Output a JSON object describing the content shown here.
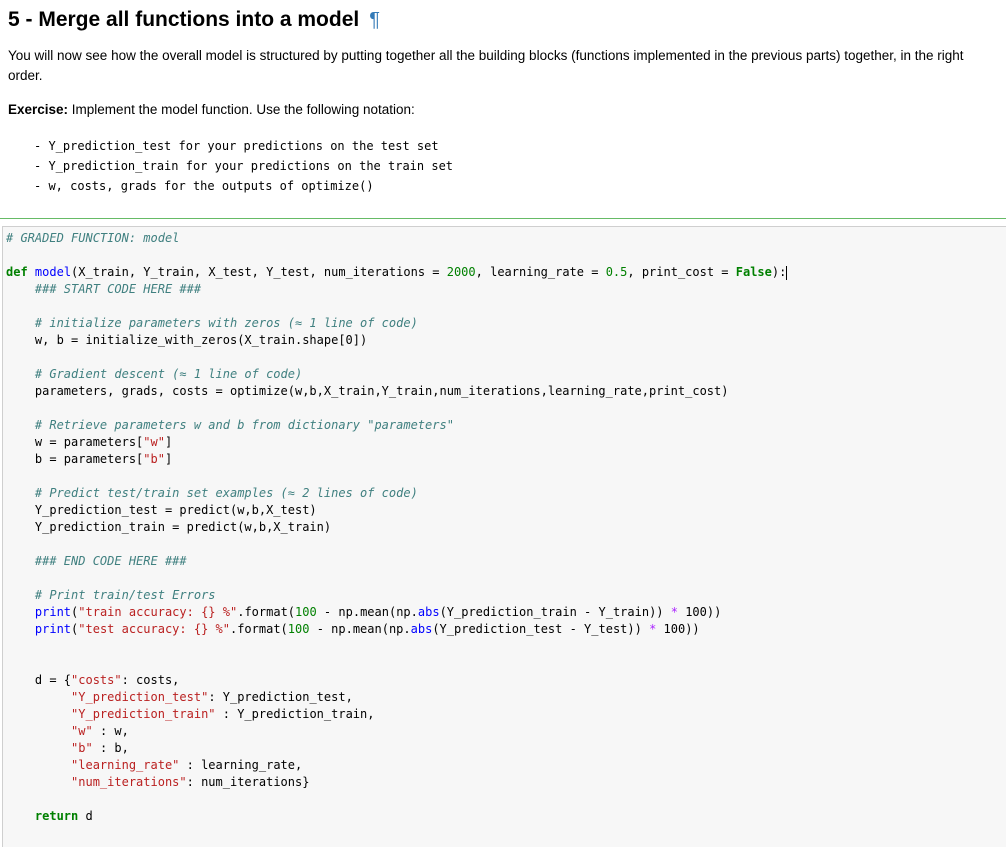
{
  "heading": {
    "title": "5 - Merge all functions into a model",
    "anchor": "¶"
  },
  "intro": "You will now see how the overall model is structured by putting together all the building blocks (functions implemented in the previous parts) together, in the right order.",
  "exercise": {
    "label": "Exercise:",
    "text": " Implement the model function. Use the following notation:"
  },
  "notes": [
    "- Y_prediction_test for your predictions on the test set",
    "- Y_prediction_train for your predictions on the train set",
    "- w, costs, grads for the outputs of optimize()"
  ],
  "code": {
    "l1": "# GRADED FUNCTION: model",
    "l3_def": "def",
    "l3_name": "model",
    "l3_a": "(X_train, Y_train, X_test, Y_test, num_iterations = ",
    "l3_n1": "2000",
    "l3_b": ", learning_rate = ",
    "l3_n2": "0.5",
    "l3_c": ", print_cost = ",
    "l3_false": "False",
    "l3_d": "):",
    "l4": "    ### START CODE HERE ###",
    "l6": "    # initialize parameters with zeros (≈ 1 line of code)",
    "l7": "    w, b = initialize_with_zeros(X_train.shape[0])",
    "l9": "    # Gradient descent (≈ 1 line of code)",
    "l10": "    parameters, grads, costs = optimize(w,b,X_train,Y_train,num_iterations,learning_rate,print_cost)",
    "l12": "    # Retrieve parameters w and b from dictionary \"parameters\"",
    "l13a": "    w = parameters[",
    "l13s": "\"w\"",
    "l13b": "]",
    "l14a": "    b = parameters[",
    "l14s": "\"b\"",
    "l14b": "]",
    "l16": "    # Predict test/train set examples (≈ 2 lines of code)",
    "l17": "    Y_prediction_test = predict(w,b,X_test)",
    "l18": "    Y_prediction_train = predict(w,b,X_train)",
    "l20": "    ### END CODE HERE ###",
    "l22": "    # Print train/test Errors",
    "p_print": "print",
    "p_open": "(",
    "l23_s": "\"train accuracy: {} %\"",
    "p_fmt": ".format(",
    "p_100": "100",
    "p_minus": " - ",
    "p_np": "np.mean(np.",
    "p_abs": "abs",
    "l23_rest": "(Y_prediction_train - Y_train)) ",
    "p_star": "*",
    "p_end": " 100))",
    "l24_s": "\"test accuracy: {} %\"",
    "l24_rest": "(Y_prediction_test - Y_test)) ",
    "d1a": "    d = {",
    "d1s": "\"costs\"",
    "d1b": ": costs,",
    "d2s": "\"Y_prediction_test\"",
    "d2b": ": Y_prediction_test,",
    "d3s": "\"Y_prediction_train\"",
    "d3b": " : Y_prediction_train,",
    "d4s": "\"w\"",
    "d4b": " : w,",
    "d5s": "\"b\"",
    "d5b": " : b,",
    "d6s": "\"learning_rate\"",
    "d6b": " : learning_rate,",
    "d7s": "\"num_iterations\"",
    "d7b": ": num_iterations}",
    "ret": "return",
    "ret_b": " d"
  }
}
